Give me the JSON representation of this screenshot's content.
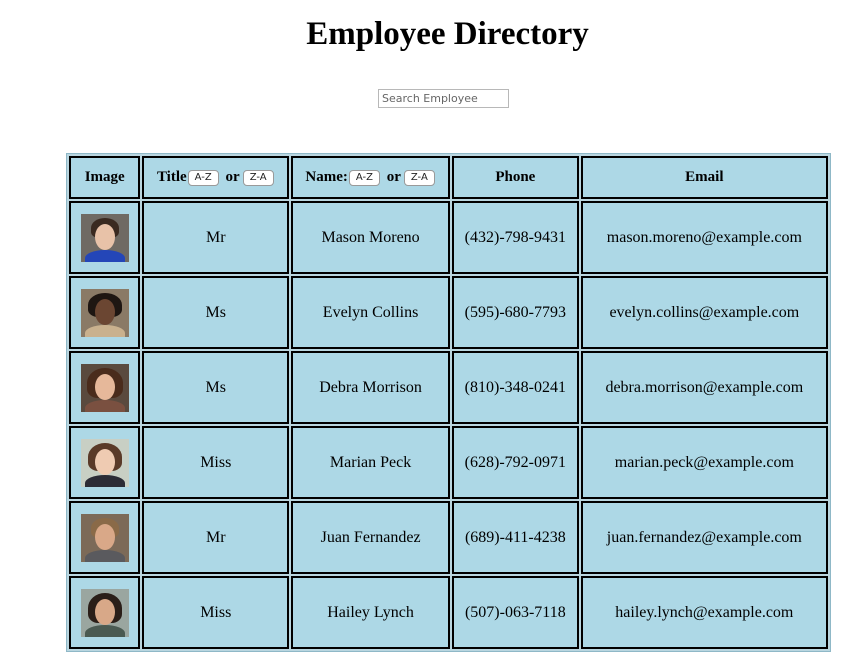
{
  "header": {
    "title": "Employee Directory"
  },
  "search": {
    "placeholder": "Search Employee",
    "value": ""
  },
  "table": {
    "columns": {
      "image": "Image",
      "title": "Title",
      "name": "Name:",
      "phone": "Phone",
      "email": "Email"
    },
    "sort": {
      "asc": "A-Z",
      "or": "or",
      "desc": "Z-A"
    },
    "rows": [
      {
        "title": "Mr",
        "name": "Mason Moreno",
        "phone": "(432)-798-9431",
        "email": "mason.moreno@example.com"
      },
      {
        "title": "Ms",
        "name": "Evelyn Collins",
        "phone": "(595)-680-7793",
        "email": "evelyn.collins@example.com"
      },
      {
        "title": "Ms",
        "name": "Debra Morrison",
        "phone": "(810)-348-0241",
        "email": "debra.morrison@example.com"
      },
      {
        "title": "Miss",
        "name": "Marian Peck",
        "phone": "(628)-792-0971",
        "email": "marian.peck@example.com"
      },
      {
        "title": "Mr",
        "name": "Juan Fernandez",
        "phone": "(689)-411-4238",
        "email": "juan.fernandez@example.com"
      },
      {
        "title": "Miss",
        "name": "Hailey Lynch",
        "phone": "(507)-063-7118",
        "email": "hailey.lynch@example.com"
      }
    ]
  },
  "colors": {
    "cell_background": "#add8e6",
    "cell_border": "#000000"
  }
}
